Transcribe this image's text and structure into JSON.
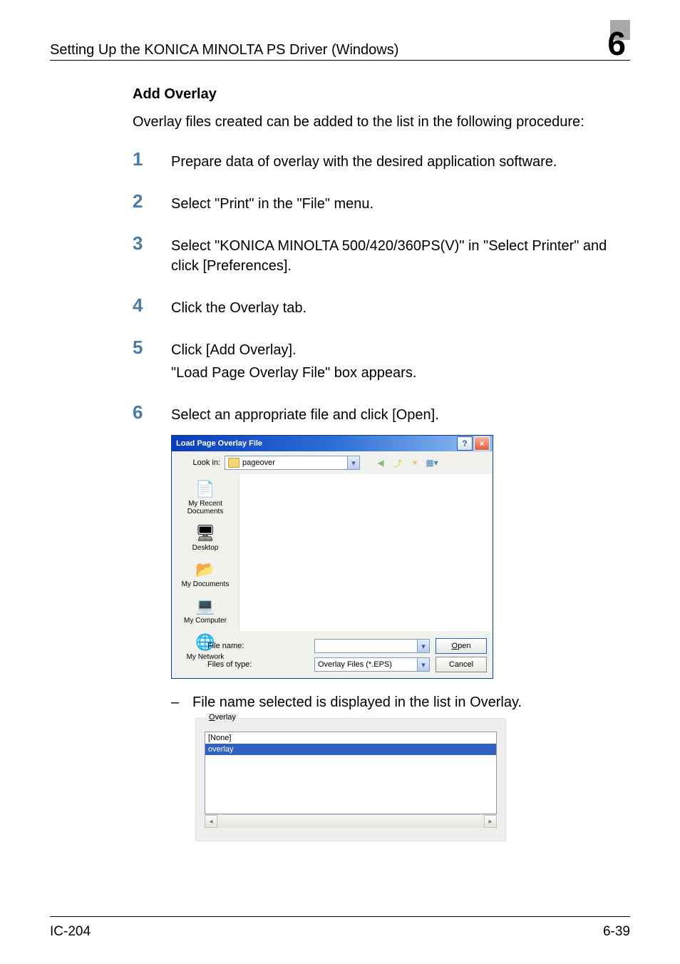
{
  "header": {
    "running_title": "Setting Up the KONICA MINOLTA PS Driver (Windows)",
    "chapter_number": "6"
  },
  "section": {
    "title": "Add Overlay",
    "intro": "Overlay files created can be added to the list in the following procedure:"
  },
  "steps": [
    {
      "n": "1",
      "lines": [
        "Prepare data of overlay with the desired application software."
      ]
    },
    {
      "n": "2",
      "lines": [
        "Select \"Print\" in the \"File\" menu."
      ]
    },
    {
      "n": "3",
      "lines": [
        "Select \"KONICA MINOLTA 500/420/360PS(V)\" in \"Select Printer\" and click [Preferences]."
      ]
    },
    {
      "n": "4",
      "lines": [
        "Click the Overlay tab."
      ]
    },
    {
      "n": "5",
      "lines": [
        "Click [Add Overlay].",
        "\"Load Page Overlay File\" box appears."
      ]
    },
    {
      "n": "6",
      "lines": [
        "Select an appropriate file and click [Open]."
      ]
    }
  ],
  "file_dialog": {
    "title": "Load Page Overlay File",
    "look_in_label": "Look in:",
    "look_in_value": "pageover",
    "places": [
      {
        "label": "My Recent Documents",
        "icon": "📄"
      },
      {
        "label": "Desktop",
        "icon": "🖥"
      },
      {
        "label": "My Documents",
        "icon": "📂"
      },
      {
        "label": "My Computer",
        "icon": "💻"
      },
      {
        "label": "My Network",
        "icon": "🌐"
      }
    ],
    "file_name_label": "File name:",
    "file_name_value": "",
    "file_type_label": "Files of type:",
    "file_type_value": "Overlay Files (*.EPS)",
    "open_btn": "Open",
    "cancel_btn": "Cancel",
    "help_btn": "?",
    "close_btn": "×",
    "toolbar_icons": {
      "back": "⟵",
      "up": "↥",
      "new": "✧",
      "views": "▦"
    }
  },
  "note": "File name selected is displayed in the list in Overlay.",
  "overlay_panel": {
    "legend_u": "O",
    "legend_rest": "verlay",
    "items": [
      {
        "text": "[None]",
        "selected": false
      },
      {
        "text": "overlay",
        "selected": true
      }
    ]
  },
  "footer": {
    "left": "IC-204",
    "right": "6-39"
  }
}
